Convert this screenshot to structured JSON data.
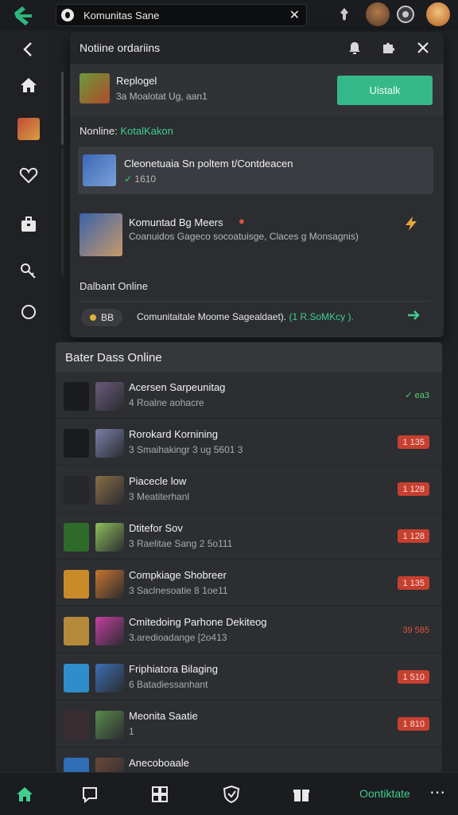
{
  "search": {
    "value": "Komunitas Sane"
  },
  "notification": {
    "title": "Notiine ordariins",
    "first": {
      "name": "Replogel",
      "sub": "3a Moalotat Ug, aan1",
      "button": "Uistalk"
    },
    "section_label": "Nonline:",
    "section_value": "KotalKakon",
    "card": {
      "title": "Cleonetuaia Sn poltem t/Contdeacen",
      "check": "✓",
      "meta": "1610"
    },
    "item": {
      "title": "Komuntad Bg Meers",
      "sub": "Coanuidos Gageco socoatuisge, Claces g Monsagnis)"
    },
    "online_label": "Dalbant Online",
    "pill": "BB",
    "footer_text": "Comunitaitale Moome Sagealdaet).",
    "footer_green": "(1 R.SoMKcy ).",
    "colors": {
      "accent": "#35b88a",
      "badge": "#c64030"
    }
  },
  "list": {
    "title": "Bater Dass Online",
    "rows": [
      {
        "name": "Acersen Sarpeunitag",
        "sub": "4 Roalne aohacre",
        "badge": "✓ ea3",
        "kind": "ok",
        "rank_color": "#1a1b1e",
        "av_color": "#6a5a7a"
      },
      {
        "name": "Rorokard Kornining",
        "sub": "3 Smaihakingr 3 ug 5601 3",
        "badge": "1 135",
        "kind": "red",
        "rank_color": "#1a1b1e",
        "av_color": "#7a7fa8"
      },
      {
        "name": "Piacecle low",
        "sub": "3 Meatiterhanl",
        "badge": "1 128",
        "kind": "red",
        "rank_color": "#26272a",
        "av_color": "#8a6d47"
      },
      {
        "name": "Dtitefor Sov",
        "sub": "3 Raelitae Sang 2 5o111",
        "badge": "1 128",
        "kind": "red",
        "rank_color": "#2e6a2a",
        "av_color": "#8fc05a"
      },
      {
        "name": "Compkiage Shobreer",
        "sub": "3 Saclnesoatie 8 1oe11",
        "badge": "1 135",
        "kind": "red",
        "rank_color": "#c98a2a",
        "av_color": "#c9742e"
      },
      {
        "name": "Cmitedoing Parhone Dekiteog",
        "sub": "3.aredioadange [2o413",
        "badge": "39 585",
        "kind": "plain",
        "rank_color": "#b58a3a",
        "av_color": "#c43fa0"
      },
      {
        "name": "Friphiatora Bilaging",
        "sub": "6 Batadiessanhant",
        "badge": "1 510",
        "kind": "red",
        "rank_color": "#2f8ec9",
        "av_color": "#3c6fb5"
      },
      {
        "name": "Meonita Saatie",
        "sub": "1",
        "badge": "1 810",
        "kind": "red",
        "rank_color": "#3a2e33",
        "av_color": "#5a8a4a"
      },
      {
        "name": "Anecoboaale",
        "sub": "",
        "badge": "",
        "kind": "red",
        "rank_color": "#2f6fb5",
        "av_color": "#6a4a3a"
      }
    ]
  },
  "bottom": {
    "label": "Oontiktate",
    "more": "⋯"
  }
}
